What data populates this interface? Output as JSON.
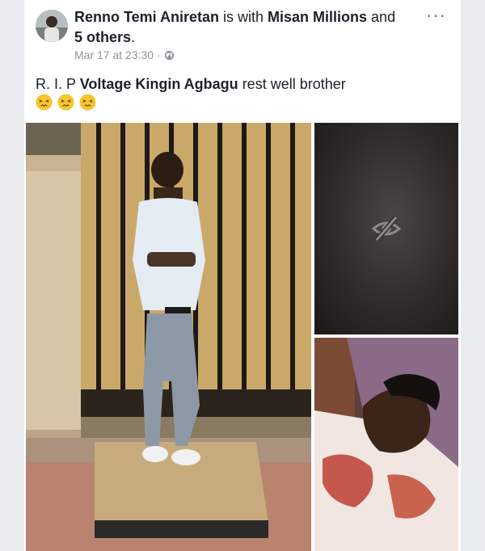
{
  "post": {
    "author": "Renno Temi Aniretan",
    "with_text": " is with ",
    "tagged_friend": "Misan Millions",
    "and_text": " and ",
    "others": "5 others",
    "period": ".",
    "timestamp": "Mar 17 at 23:30",
    "separator": "·",
    "privacy_icon": "globe-icon",
    "more_icon": "more-options-icon",
    "more_label": "···"
  },
  "caption": {
    "prefix": "R. I. P ",
    "tagged_person": "Voltage Kingin Agbagu",
    "suffix": " rest well brother",
    "emojis": [
      "confounded-face",
      "confounded-face",
      "confounded-face"
    ]
  },
  "photos": {
    "count": 3,
    "hidden_icon": "eye-slash-icon"
  }
}
